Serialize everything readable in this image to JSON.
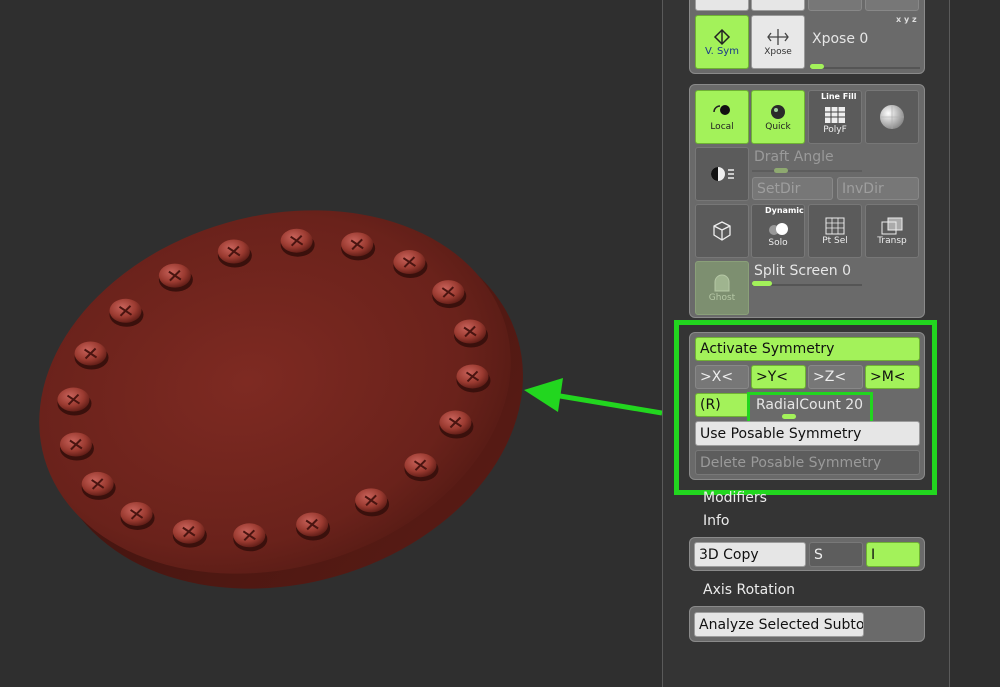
{
  "top_group": {
    "vsym_label": "V. Sym",
    "xpose_icon_label": "Xpose",
    "xpose_slider_label": "Xpose 0",
    "corner_marks": "x y z"
  },
  "transform_group": {
    "local_label": "Local",
    "quick_label": "Quick",
    "polyf_label": "PolyF",
    "line_fill_label": "Line Fill",
    "draft_angle_label": "Draft Angle",
    "setdir_label": "SetDir",
    "invdir_label": "InvDir",
    "solo_label": "Solo",
    "dynamic_label": "Dynamic",
    "ptsel_label": "Pt Sel",
    "transp_label": "Transp",
    "ghost_label": "Ghost",
    "split_screen_label": "Split Screen 0"
  },
  "symmetry_group": {
    "activate_label": "Activate Symmetry",
    "x_label": ">X<",
    "y_label": ">Y<",
    "z_label": ">Z<",
    "m_label": ">M<",
    "r_label": "(R)",
    "radial_label": "RadialCount 20",
    "radial_value": 20,
    "use_posable_label": "Use Posable Symmetry",
    "delete_posable_label": "Delete Posable Symmetry"
  },
  "sections": {
    "modifiers": "Modifiers",
    "info": "Info",
    "axis_rotation": "Axis Rotation"
  },
  "copy_group": {
    "copy3d_label": "3D Copy",
    "s_label": "S",
    "i_label": "I"
  },
  "analyze_group": {
    "analyze_label": "Analyze Selected Subtool"
  },
  "colors": {
    "accent_green": "#a3f25a",
    "highlight_green": "#22d61f",
    "model_color": "#7a2a20"
  },
  "model": {
    "stud_count": 20
  }
}
